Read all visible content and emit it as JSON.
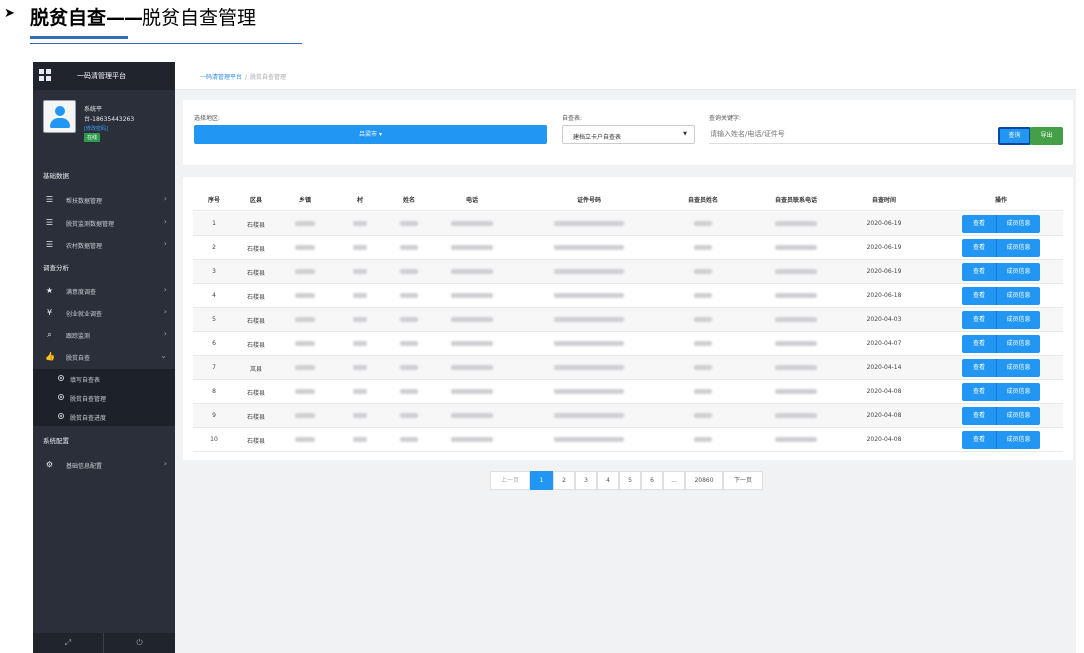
{
  "doc": {
    "arrow": "➤",
    "title_bold": "脱贫自查",
    "dash": "——",
    "title_sub": "脱贫自查管理"
  },
  "app": {
    "brand": "一码清管理平台",
    "user": {
      "name": "系统平",
      "phone": "台-18635443263",
      "edit_link": "[修改密码]",
      "status": "在线"
    },
    "sidebar": {
      "section_base": "基础数据",
      "items_base": [
        {
          "label": "帮扶数据管理",
          "icon": "list-icon"
        },
        {
          "label": "脱贫监测数据管理",
          "icon": "list-icon"
        },
        {
          "label": "农村数据管理",
          "icon": "list-icon"
        }
      ],
      "section_survey": "调查分析",
      "items_survey": [
        {
          "label": "满意度调查",
          "icon": "star-icon"
        },
        {
          "label": "创业就业调查",
          "icon": "yen-icon"
        },
        {
          "label": "跟踪监测",
          "icon": "search-icon"
        },
        {
          "label": "脱贫自查",
          "icon": "thumbs-up-icon"
        }
      ],
      "sub_items": [
        {
          "label": "填写自查表"
        },
        {
          "label": "脱贫自查管理"
        },
        {
          "label": "脱贫自查进度"
        }
      ],
      "section_config": "系统配置",
      "items_config": [
        {
          "label": "基础信息配置",
          "icon": "gear-icon"
        }
      ],
      "footer_left": "⤢",
      "footer_right": "⏻"
    },
    "breadcrumb": {
      "root": "一码清管理平台",
      "sep": "/",
      "current": "脱贫自查管理"
    },
    "filter": {
      "region_label": "选择地区:",
      "region_value": "吕梁市 ▾",
      "table_label": "自查表:",
      "table_value": "建档立卡户自查表",
      "keyword_label": "查询关键字:",
      "keyword_placeholder": "请输入姓名/电话/证件号",
      "query_btn": "查询",
      "export_btn": "导出"
    },
    "table": {
      "headers": [
        "序号",
        "区县",
        "乡镇",
        "村",
        "姓名",
        "电话",
        "证件号码",
        "自查员姓名",
        "自查员联系电话",
        "自查时间",
        "操作"
      ],
      "rows": [
        {
          "no": "1",
          "county": "石楼县",
          "date": "2020-06-19"
        },
        {
          "no": "2",
          "county": "石楼县",
          "date": "2020-06-19"
        },
        {
          "no": "3",
          "county": "石楼县",
          "date": "2020-06-19"
        },
        {
          "no": "4",
          "county": "石楼县",
          "date": "2020-06-18"
        },
        {
          "no": "5",
          "county": "石楼县",
          "date": "2020-04-03"
        },
        {
          "no": "6",
          "county": "石楼县",
          "date": "2020-04-07"
        },
        {
          "no": "7",
          "county": "岚县",
          "date": "2020-04-14"
        },
        {
          "no": "8",
          "county": "石楼县",
          "date": "2020-04-08"
        },
        {
          "no": "9",
          "county": "石楼县",
          "date": "2020-04-08"
        },
        {
          "no": "10",
          "county": "石楼县",
          "date": "2020-04-08"
        }
      ],
      "view_btn": "查看",
      "member_btn": "成员信息"
    },
    "pagination": {
      "prev": "上一页",
      "pages": [
        "1",
        "2",
        "3",
        "4",
        "5",
        "6",
        "...",
        "20860"
      ],
      "active": "1",
      "next": "下一页"
    },
    "colors": {
      "primary": "#2196f3",
      "sidebar_bg": "#2a2f3a",
      "export_green": "#43a047",
      "status_green": "#2e9a4e"
    }
  }
}
